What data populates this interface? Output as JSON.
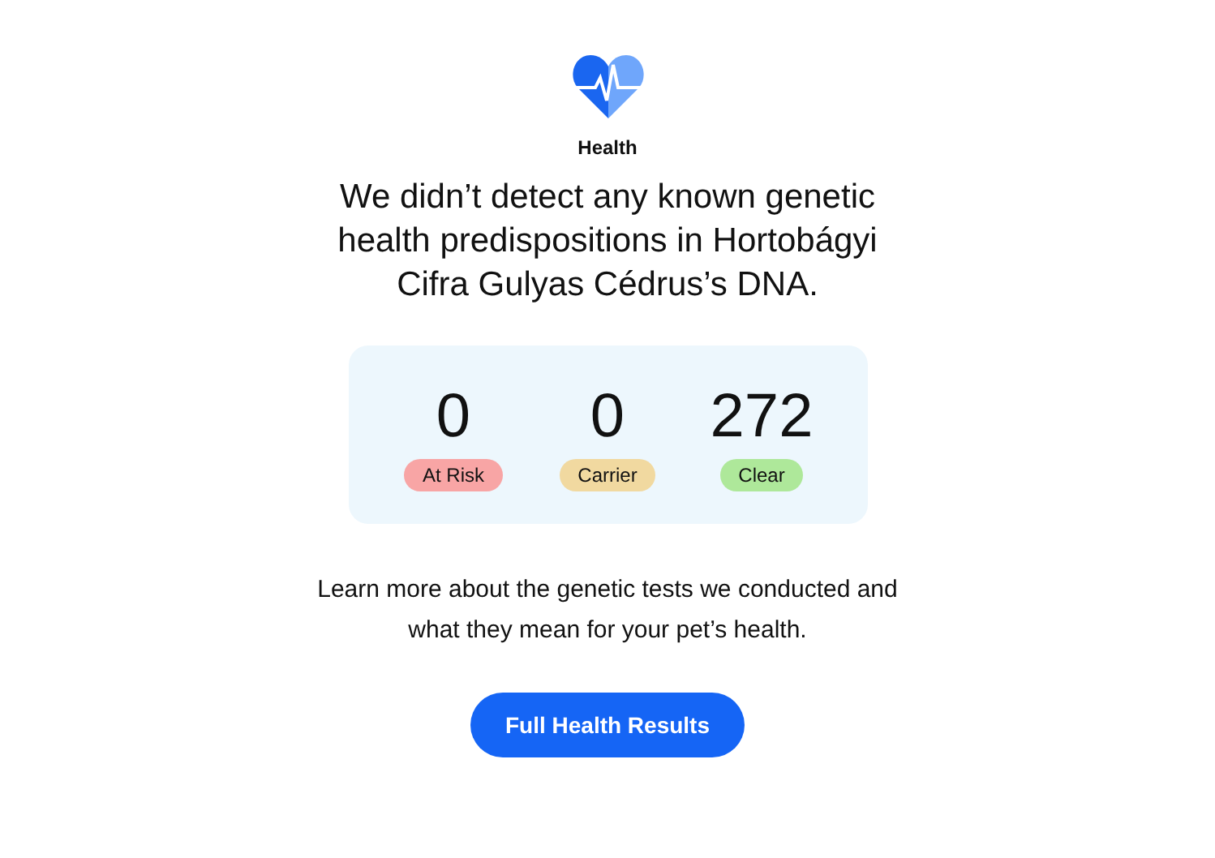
{
  "section": {
    "title": "Health"
  },
  "headline": "We didn’t detect any known genetic health predispositions in Hortobágyi Cifra Gulyas Cédrus’s DNA.",
  "summary": [
    {
      "count": "0",
      "label": "At Risk",
      "color": "#f8a5a5"
    },
    {
      "count": "0",
      "label": "Carrier",
      "color": "#f1d9a0"
    },
    {
      "count": "272",
      "label": "Clear",
      "color": "#aee89a"
    }
  ],
  "description": "Learn more about the genetic tests we conducted and what they mean for your pet’s health.",
  "button": "Full Health Results"
}
